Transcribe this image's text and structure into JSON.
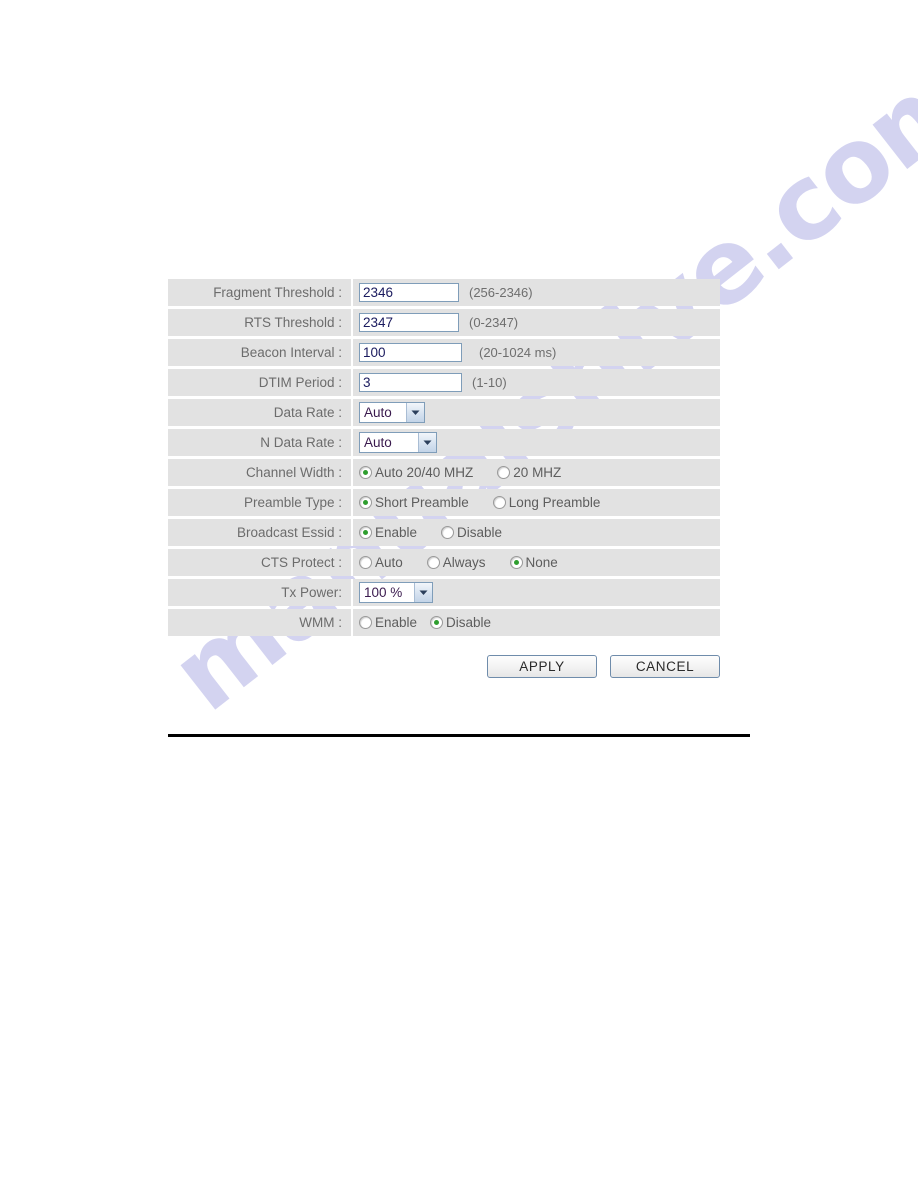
{
  "form": {
    "rows": [
      {
        "label": "Fragment Threshold :",
        "type": "text",
        "value": "2346",
        "hint": "(256-2346)"
      },
      {
        "label": "RTS Threshold :",
        "type": "text",
        "value": "2347",
        "hint": "(0-2347)"
      },
      {
        "label": "Beacon Interval :",
        "type": "text",
        "value": "100",
        "hint": "(20-1024 ms)"
      },
      {
        "label": "DTIM Period :",
        "type": "text",
        "value": "3",
        "hint": "(1-10)"
      },
      {
        "label": "Data Rate :",
        "type": "select",
        "value": "Auto"
      },
      {
        "label": "N Data Rate :",
        "type": "select",
        "value": "Auto"
      },
      {
        "label": "Channel Width :",
        "type": "radio",
        "options": [
          {
            "label": "Auto 20/40 MHZ",
            "selected": true
          },
          {
            "label": "20 MHZ",
            "selected": false
          }
        ]
      },
      {
        "label": "Preamble Type :",
        "type": "radio",
        "options": [
          {
            "label": "Short Preamble",
            "selected": true
          },
          {
            "label": "Long Preamble",
            "selected": false
          }
        ]
      },
      {
        "label": "Broadcast Essid :",
        "type": "radio",
        "options": [
          {
            "label": "Enable",
            "selected": true
          },
          {
            "label": "Disable",
            "selected": false
          }
        ]
      },
      {
        "label": "CTS Protect :",
        "type": "radio",
        "options": [
          {
            "label": "Auto",
            "selected": false
          },
          {
            "label": "Always",
            "selected": false
          },
          {
            "label": "None",
            "selected": true
          }
        ]
      },
      {
        "label": "Tx Power:",
        "type": "select",
        "value": "100 %"
      },
      {
        "label": "WMM :",
        "type": "radio",
        "options": [
          {
            "label": "Enable",
            "selected": false
          },
          {
            "label": "Disable",
            "selected": true
          }
        ]
      }
    ]
  },
  "buttons": {
    "apply": "APPLY",
    "cancel": "CANCEL"
  },
  "watermark": {
    "text": "manualshive.com"
  },
  "colors": {
    "row_background": "#e2e2e2",
    "label_text": "#6c6c6c",
    "input_text": "#1a1a5e",
    "input_border": "#7f9db9",
    "radio_dot": "#2f9e2f",
    "watermark": "#b9b9e8",
    "divider": "#000000"
  }
}
